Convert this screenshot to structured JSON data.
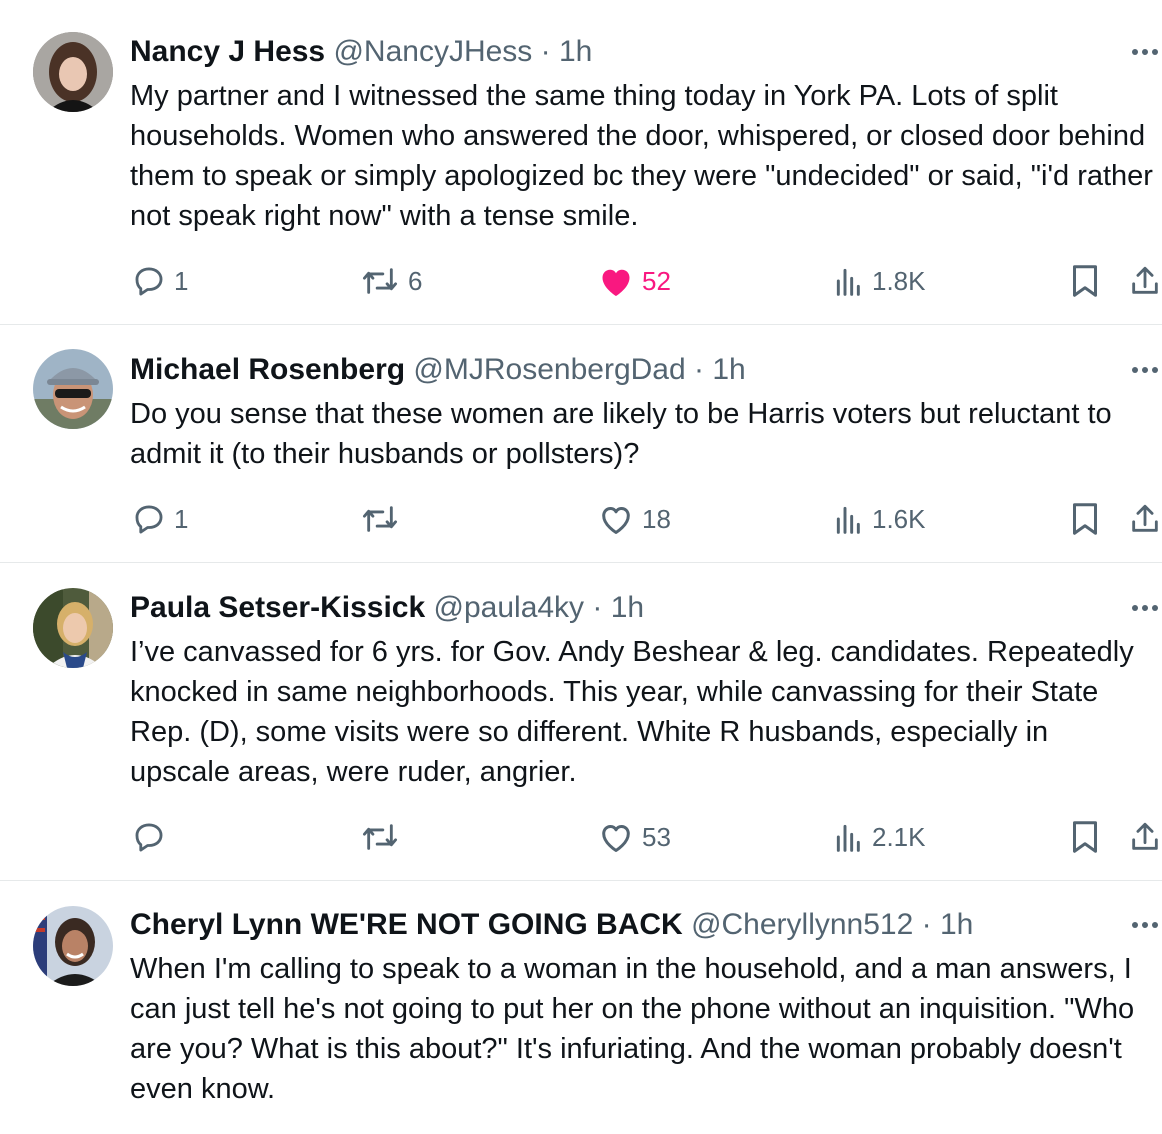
{
  "tweets": [
    {
      "name": "Nancy J Hess",
      "handle": "@NancyJHess",
      "time": "· 1h",
      "text": "My partner and I witnessed the same thing today in York PA. Lots of split households.  Women who answered the door, whispered, or closed door behind them to speak or simply apologized bc they were \"undecided\" or said, \"i'd rather not speak right now\" with a tense smile.",
      "replies": "1",
      "reposts": "6",
      "likes": "52",
      "liked": true,
      "views": "1.8K"
    },
    {
      "name": "Michael Rosenberg",
      "handle": "@MJRosenbergDad",
      "time": "· 1h",
      "text": "Do you sense that these women are likely to be Harris voters but reluctant to admit it (to their husbands or pollsters)?",
      "replies": "1",
      "reposts": "",
      "likes": "18",
      "liked": false,
      "views": "1.6K"
    },
    {
      "name": "Paula Setser-Kissick",
      "handle": "@paula4ky",
      "time": "· 1h",
      "text": "I’ve canvassed for 6 yrs. for Gov. Andy Beshear & leg. candidates. Repeatedly knocked in same neighborhoods. This year, while canvassing for their State Rep. (D), some visits were so different. White R husbands, especially in upscale areas, were ruder, angrier.",
      "replies": "",
      "reposts": "",
      "likes": "53",
      "liked": false,
      "views": "2.1K"
    },
    {
      "name": "Cheryl Lynn WE'RE NOT GOING BACK",
      "handle": "@Cheryllynn512",
      "time": "· 1h",
      "text": "When I'm calling to speak to a woman in the household, and a man answers, I can just tell he's not going to put her on the phone without an inquisition. \"Who are you? What is this about?\" It's infuriating. And the woman probably doesn't even know.",
      "replies": "",
      "reposts": "",
      "likes": "",
      "liked": false,
      "views": ""
    }
  ],
  "colors": {
    "text": "#0f1419",
    "secondary": "#536471",
    "like_active": "#f91880",
    "divider": "#e6e9ea"
  },
  "icons": [
    "reply-icon",
    "repost-icon",
    "like-icon",
    "views-icon",
    "bookmark-icon",
    "share-icon",
    "more-icon"
  ]
}
